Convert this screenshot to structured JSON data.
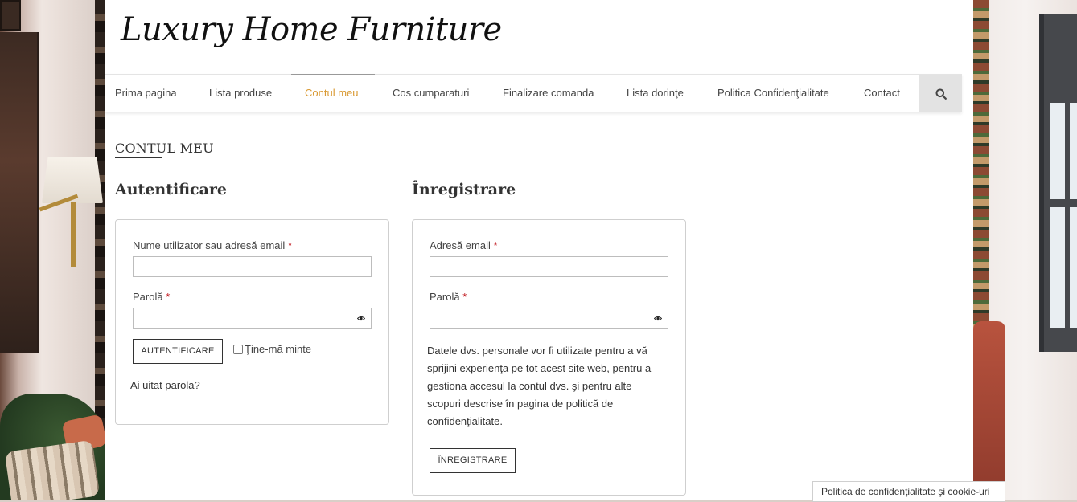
{
  "site": {
    "logo_text": "Luxury Home Furniture"
  },
  "nav": {
    "items": [
      {
        "label": "Prima pagina"
      },
      {
        "label": "Lista produse"
      },
      {
        "label": "Contul meu"
      },
      {
        "label": "Cos cumparaturi"
      },
      {
        "label": "Finalizare comanda"
      },
      {
        "label": "Lista dorinţe"
      },
      {
        "label": "Politica Confidenţialitate"
      },
      {
        "label": "Contact"
      }
    ],
    "active_item": "Contul meu",
    "search_icon": "search-icon",
    "accent_color": "#d99a34"
  },
  "page": {
    "title": "CONTUL MEU"
  },
  "login": {
    "heading": "Autentificare",
    "username_label": "Nume utilizator sau adresă email",
    "password_label": "Parolă",
    "required_mark": "*",
    "submit_label": "AUTENTIFICARE",
    "remember_label": "Ţine-mă minte",
    "lost_password_label": "Ai uitat parola?"
  },
  "register": {
    "heading": "Înregistrare",
    "email_label": "Adresă email",
    "password_label": "Parolă",
    "required_mark": "*",
    "privacy_text": "Datele dvs. personale vor fi utilizate pentru a vă sprijini experienţa pe tot acest site web, pentru a gestiona accesul la contul dvs. şi pentru alte scopuri descrise în pagina de politică de confidenţialitate.",
    "submit_label": "ÎNREGISTRARE"
  },
  "cookie": {
    "label": "Politica de confidenţialitate şi cookie-uri"
  }
}
